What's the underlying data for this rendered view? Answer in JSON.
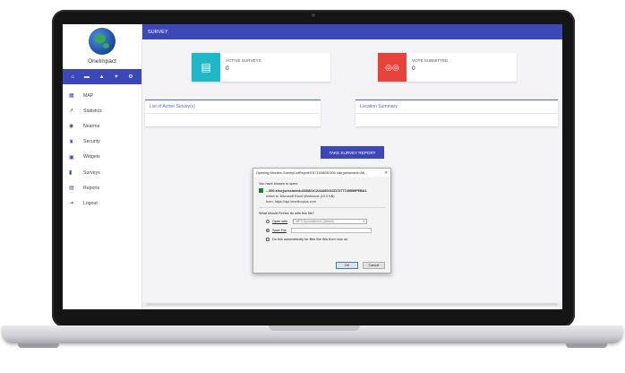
{
  "app": {
    "brand": "OneImpact"
  },
  "iconbar": [
    {
      "icon": "home-icon",
      "glyph": "⌂"
    },
    {
      "icon": "bus-icon",
      "glyph": "▬"
    },
    {
      "icon": "bell-icon",
      "glyph": "▲"
    },
    {
      "icon": "tool-icon",
      "glyph": "✦"
    },
    {
      "icon": "settings-icon",
      "glyph": "⚙"
    }
  ],
  "sidebar": {
    "items": [
      {
        "label": "MAP",
        "glyph": "▦"
      },
      {
        "label": "Statistics",
        "glyph": "↗"
      },
      {
        "label": "Nearme",
        "glyph": "◉"
      },
      {
        "label": "Security",
        "glyph": "♜"
      },
      {
        "label": "Widgets",
        "glyph": "▣"
      },
      {
        "label": "Surveys",
        "glyph": "▮"
      },
      {
        "label": "Reports",
        "glyph": "▤"
      },
      {
        "label": "Logout",
        "glyph": "⇥"
      }
    ]
  },
  "header": {
    "title": "SURVEY"
  },
  "stats": [
    {
      "label": "ACTIVE SURVEYS",
      "value": "0",
      "color": "#1fb8c9",
      "icon": "clipboard-icon",
      "glyph": "▤"
    },
    {
      "label": "VOTE SUBMITTED",
      "value": "0",
      "color": "#e8433a",
      "icon": "glasses-icon",
      "glyph": "◎◎"
    }
  ],
  "panels": {
    "left": "List of Active Survey(s)",
    "right": "Location Summary"
  },
  "report_button": "TAKE SURVEY REPORT",
  "dialog": {
    "title": "Opening iMonitor-SurveyListReport20171006030300.xlsx;jsessionid=A6...",
    "intro": "You have chosen to open:",
    "filename": "...300.xlsx;jsessionid=A60821C224A6021CD7277745559FEBA1",
    "which_is": "which is: Microsoft Excel Workbook (10.0 KB)",
    "from": "from: https://api.imonitorplus.com",
    "question": "What should Firefox do with this file?",
    "open_with_label": "Open with",
    "open_with_value": "WPS Spreadsheets (default)",
    "save_label": "Save File",
    "auto_label": "Do this automatically for files like this from now on.",
    "ok": "OK",
    "cancel": "Cancel",
    "selected_option": "save"
  }
}
